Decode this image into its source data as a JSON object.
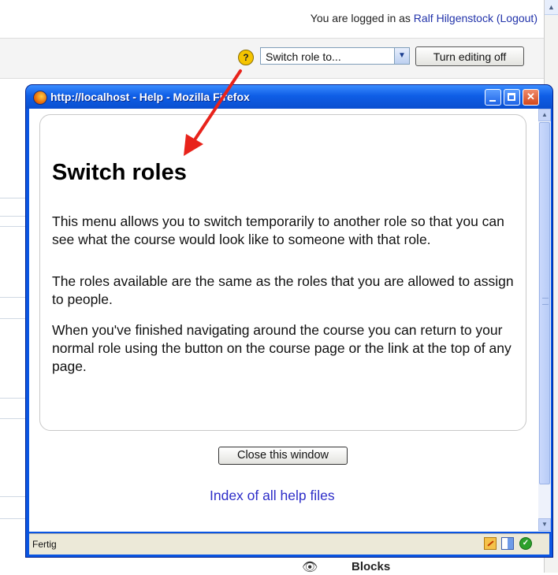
{
  "background": {
    "login_prefix": "You are logged in as ",
    "user_name": "Ralf Hilgenstock",
    "logout_label": "(Logout)",
    "switch_role_select": "Switch role to...",
    "turn_editing_button": "Turn editing off",
    "help_icon_glyph": "?",
    "blocks_label": "Blocks"
  },
  "popup": {
    "window_title": "http://localhost - Help - Mozilla Firefox",
    "heading": "Switch roles",
    "paragraphs": [
      "This menu allows you to switch temporarily to another role so that you can see what the course would look like to someone with that role.",
      "The roles available are the same as the roles that you are allowed to assign to people.",
      "When you've finished navigating around the course you can return to your normal role using the button on the course page or the link at the top of any page."
    ],
    "close_button": "Close this window",
    "help_index_link": "Index of all help files",
    "status_text": "Fertig"
  },
  "colors": {
    "titlebar_blue": "#0a55e2",
    "link_blue": "#2d2dc8",
    "arrow_red": "#e8231b"
  },
  "icons": {
    "browser": "firefox-icon",
    "help": "help-question-icon",
    "status": [
      "edit-page-icon",
      "page-icon",
      "ok-check-icon"
    ]
  }
}
